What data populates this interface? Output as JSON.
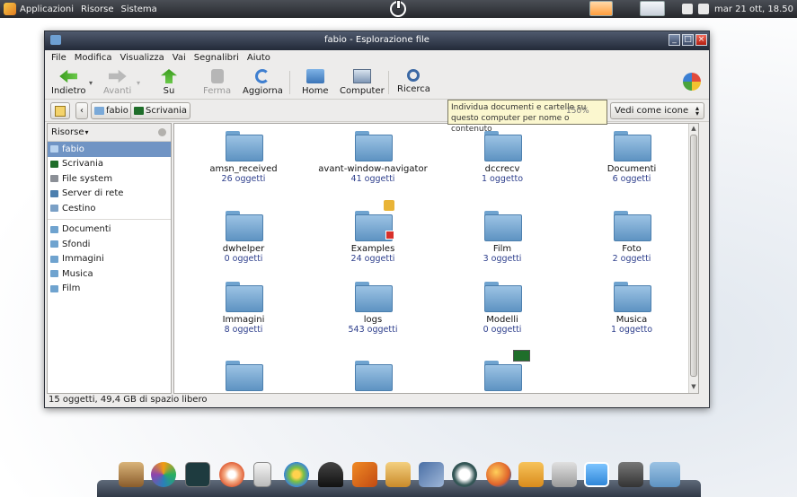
{
  "top_panel": {
    "menus": [
      "Applicazioni",
      "Risorse",
      "Sistema"
    ],
    "clock": "mar 21 ott, 18.50"
  },
  "window": {
    "title": "fabio - Esplorazione file",
    "menu": [
      "File",
      "Modifica",
      "Visualizza",
      "Vai",
      "Segnalibri",
      "Aiuto"
    ],
    "toolbar": {
      "back": "Indietro",
      "forward": "Avanti",
      "up": "Su",
      "stop": "Ferma",
      "reload": "Aggiorna",
      "home": "Home",
      "computer": "Computer",
      "search": "Ricerca"
    },
    "location": {
      "crumbs": [
        "fabio",
        "Scrivania"
      ],
      "zoom": "150%",
      "view_mode": "Vedi come icone"
    },
    "tooltip": {
      "line1": "Individua documenti e cartelle su",
      "line2": "questo computer per nome o contenuto"
    },
    "sidebar": {
      "header": "Risorse",
      "places": [
        "fabio",
        "Scrivania",
        "File system",
        "Server di rete",
        "Cestino"
      ],
      "bookmarks": [
        "Documenti",
        "Sfondi",
        "Immagini",
        "Musica",
        "Film"
      ]
    },
    "files": [
      {
        "name": "amsn_received",
        "count": "26 oggetti"
      },
      {
        "name": "avant-window-navigator",
        "count": "41 oggetti"
      },
      {
        "name": "dccrecv",
        "count": "1 oggetto"
      },
      {
        "name": "Documenti",
        "count": "6 oggetti"
      },
      {
        "name": "dwhelper",
        "count": "0 oggetti"
      },
      {
        "name": "Examples",
        "count": "24 oggetti"
      },
      {
        "name": "Film",
        "count": "3 oggetti"
      },
      {
        "name": "Foto",
        "count": "2 oggetti"
      },
      {
        "name": "Immagini",
        "count": "8 oggetti"
      },
      {
        "name": "logs",
        "count": "543 oggetti"
      },
      {
        "name": "Modelli",
        "count": "0 oggetti"
      },
      {
        "name": "Musica",
        "count": "1 oggetto"
      },
      {
        "name": "",
        "count": ""
      },
      {
        "name": "",
        "count": ""
      },
      {
        "name": "",
        "count": ""
      }
    ],
    "status": "15 oggetti, 49,4 GB di spazio libero"
  },
  "colors": {
    "selection": "#7094c4",
    "folder": "#7eaed6",
    "titlebar": "#2d3545",
    "tooltip": "#fbf7cf"
  },
  "dock": {
    "icons": [
      "gimp-icon",
      "msn-icon",
      "terminal-icon",
      "cd-burner-icon",
      "ipod-icon",
      "molecule-icon",
      "nautilus-icon",
      "bookmark-icon",
      "archive-icon",
      "screenshot-icon",
      "network-icon",
      "firefox-icon",
      "music-folder-icon",
      "tools-icon",
      "chat-icon",
      "settings-icon",
      "folder-icon"
    ]
  }
}
